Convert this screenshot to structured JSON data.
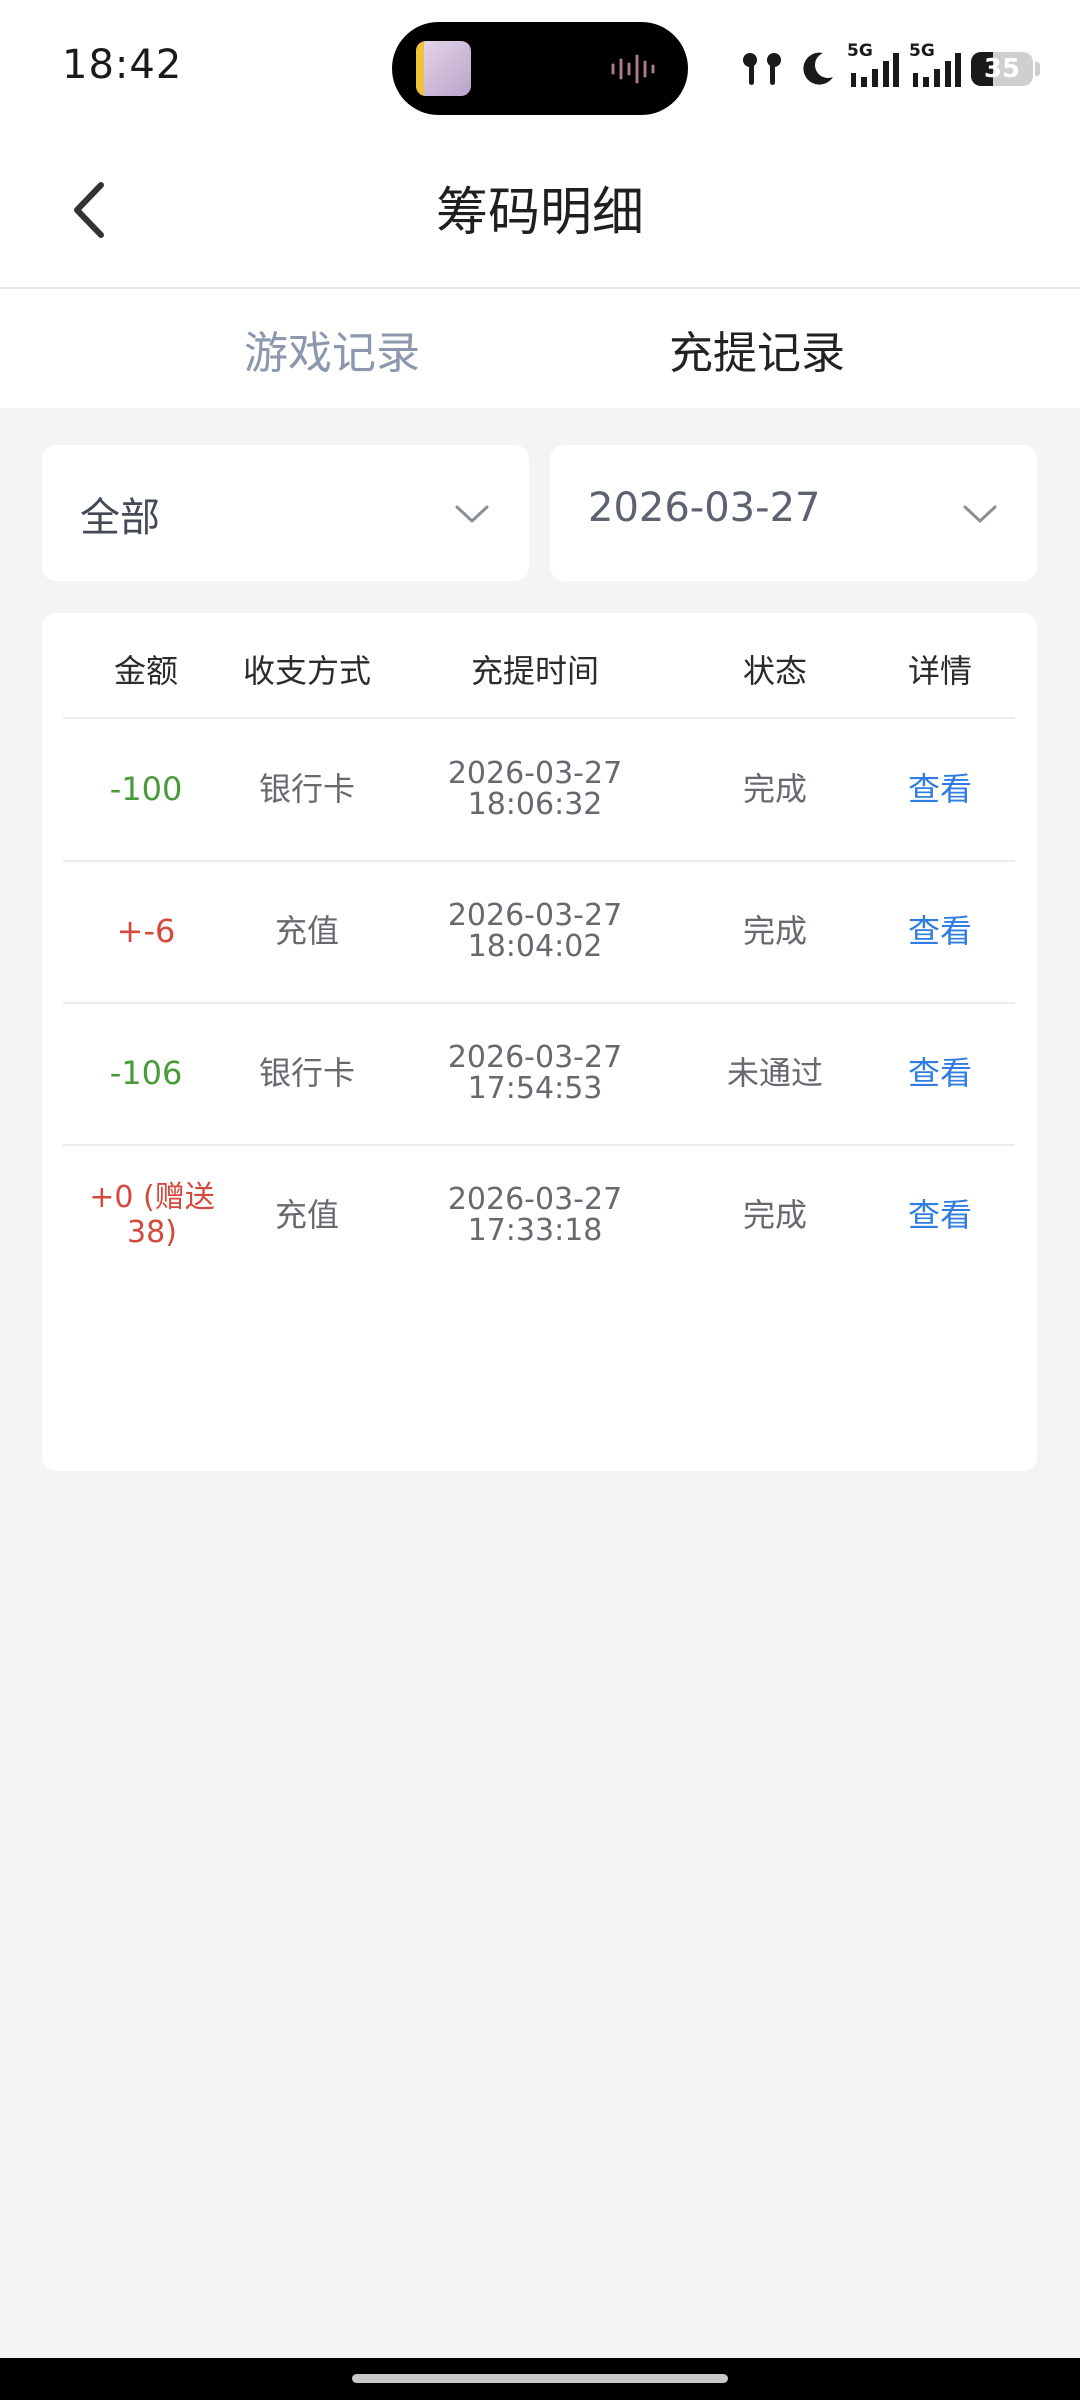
{
  "status_bar": {
    "time": "18:42",
    "network_1": "5G",
    "network_2": "5G",
    "battery": "35",
    "battery_level": 0.35
  },
  "header": {
    "title": "筹码明细",
    "back_icon": "chevron-left-icon"
  },
  "tabs": [
    {
      "label": "游戏记录",
      "active": false
    },
    {
      "label": "充提记录",
      "active": true
    }
  ],
  "filters": {
    "type_value": "全部",
    "date_value": "2026-03-27"
  },
  "table": {
    "columns": [
      "金额",
      "收支方式",
      "充提时间",
      "状态",
      "详情"
    ],
    "rows": [
      {
        "amount": "-100",
        "method": "银行卡",
        "date": "2026-03-27",
        "time": "18:06:32",
        "status": "完成",
        "detail": "查看",
        "tone": "negative"
      },
      {
        "amount": "+-6",
        "method": "充值",
        "date": "2026-03-27",
        "time": "18:04:02",
        "status": "完成",
        "detail": "查看",
        "tone": "positive"
      },
      {
        "amount": "-106",
        "method": "银行卡",
        "date": "2026-03-27",
        "time": "17:54:53",
        "status": "未通过",
        "detail": "查看",
        "tone": "negative"
      },
      {
        "amount": "+0 (赠送38)",
        "method": "充值",
        "date": "2026-03-27",
        "time": "17:33:18",
        "status": "完成",
        "detail": "查看",
        "tone": "positive"
      }
    ]
  },
  "colors": {
    "negative": "#4a9a3a",
    "positive": "#d4493c",
    "link": "#2f7ce3",
    "inactive_tab": "#8c98ad"
  }
}
